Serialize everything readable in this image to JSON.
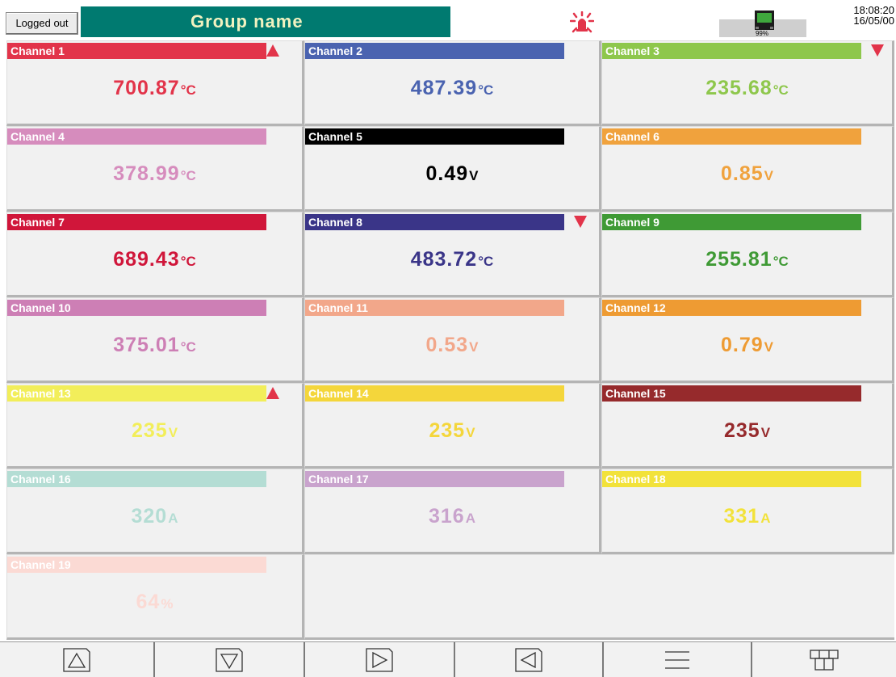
{
  "header": {
    "login_label": "Logged out",
    "group_name": "Group name",
    "memory_percent": "99%",
    "time": "18:08:20",
    "date": "16/05/00"
  },
  "channels": [
    {
      "label": "Channel 1",
      "value": "700.87",
      "unit": "°C",
      "color": "#e2344a",
      "alarm": "up"
    },
    {
      "label": "Channel 2",
      "value": "487.39",
      "unit": "°C",
      "color": "#4a63b0",
      "alarm": ""
    },
    {
      "label": "Channel 3",
      "value": "235.68",
      "unit": "°C",
      "color": "#8ec74c",
      "alarm": "down"
    },
    {
      "label": "Channel 4",
      "value": "378.99",
      "unit": "°C",
      "color": "#d68cbd",
      "alarm": ""
    },
    {
      "label": "Channel 5",
      "value": "0.49",
      "unit": "V",
      "color": "#000000",
      "alarm": ""
    },
    {
      "label": "Channel 6",
      "value": "0.85",
      "unit": "V",
      "color": "#f0a23d",
      "alarm": ""
    },
    {
      "label": "Channel 7",
      "value": "689.43",
      "unit": "°C",
      "color": "#d0163a",
      "alarm": ""
    },
    {
      "label": "Channel 8",
      "value": "483.72",
      "unit": "°C",
      "color": "#3a3588",
      "alarm": "down"
    },
    {
      "label": "Channel 9",
      "value": "255.81",
      "unit": "°C",
      "color": "#3f9a35",
      "alarm": ""
    },
    {
      "label": "Channel 10",
      "value": "375.01",
      "unit": "°C",
      "color": "#cd7fb5",
      "alarm": ""
    },
    {
      "label": "Channel 11",
      "value": "0.53",
      "unit": "V",
      "color": "#f2a78a",
      "alarm": ""
    },
    {
      "label": "Channel 12",
      "value": "0.79",
      "unit": "V",
      "color": "#ee9b33",
      "alarm": ""
    },
    {
      "label": "Channel 13",
      "value": "235",
      "unit": "V",
      "color": "#f2ee5a",
      "alarm": "up"
    },
    {
      "label": "Channel 14",
      "value": "235",
      "unit": "V",
      "color": "#f4d63b",
      "alarm": ""
    },
    {
      "label": "Channel 15",
      "value": "235",
      "unit": "V",
      "color": "#962a2c",
      "alarm": ""
    },
    {
      "label": "Channel 16",
      "value": "320",
      "unit": "A",
      "color": "#b4ddd4",
      "alarm": ""
    },
    {
      "label": "Channel 17",
      "value": "316",
      "unit": "A",
      "color": "#c9a3cd",
      "alarm": ""
    },
    {
      "label": "Channel 18",
      "value": "331",
      "unit": "A",
      "color": "#f2e23a",
      "alarm": ""
    },
    {
      "label": "Channel 19",
      "value": "64",
      "unit": "%",
      "color": "#fbdad4",
      "alarm": ""
    }
  ],
  "colors": {
    "title_bar": "#007a70",
    "alarm_red": "#e2344a",
    "panel_bg": "#f1f1f1"
  },
  "footer": {
    "buttons": [
      "up-triangle-icon",
      "down-triangle-icon",
      "right-triangle-icon",
      "left-triangle-icon",
      "menu-lines-icon",
      "layout-grid-icon"
    ]
  }
}
